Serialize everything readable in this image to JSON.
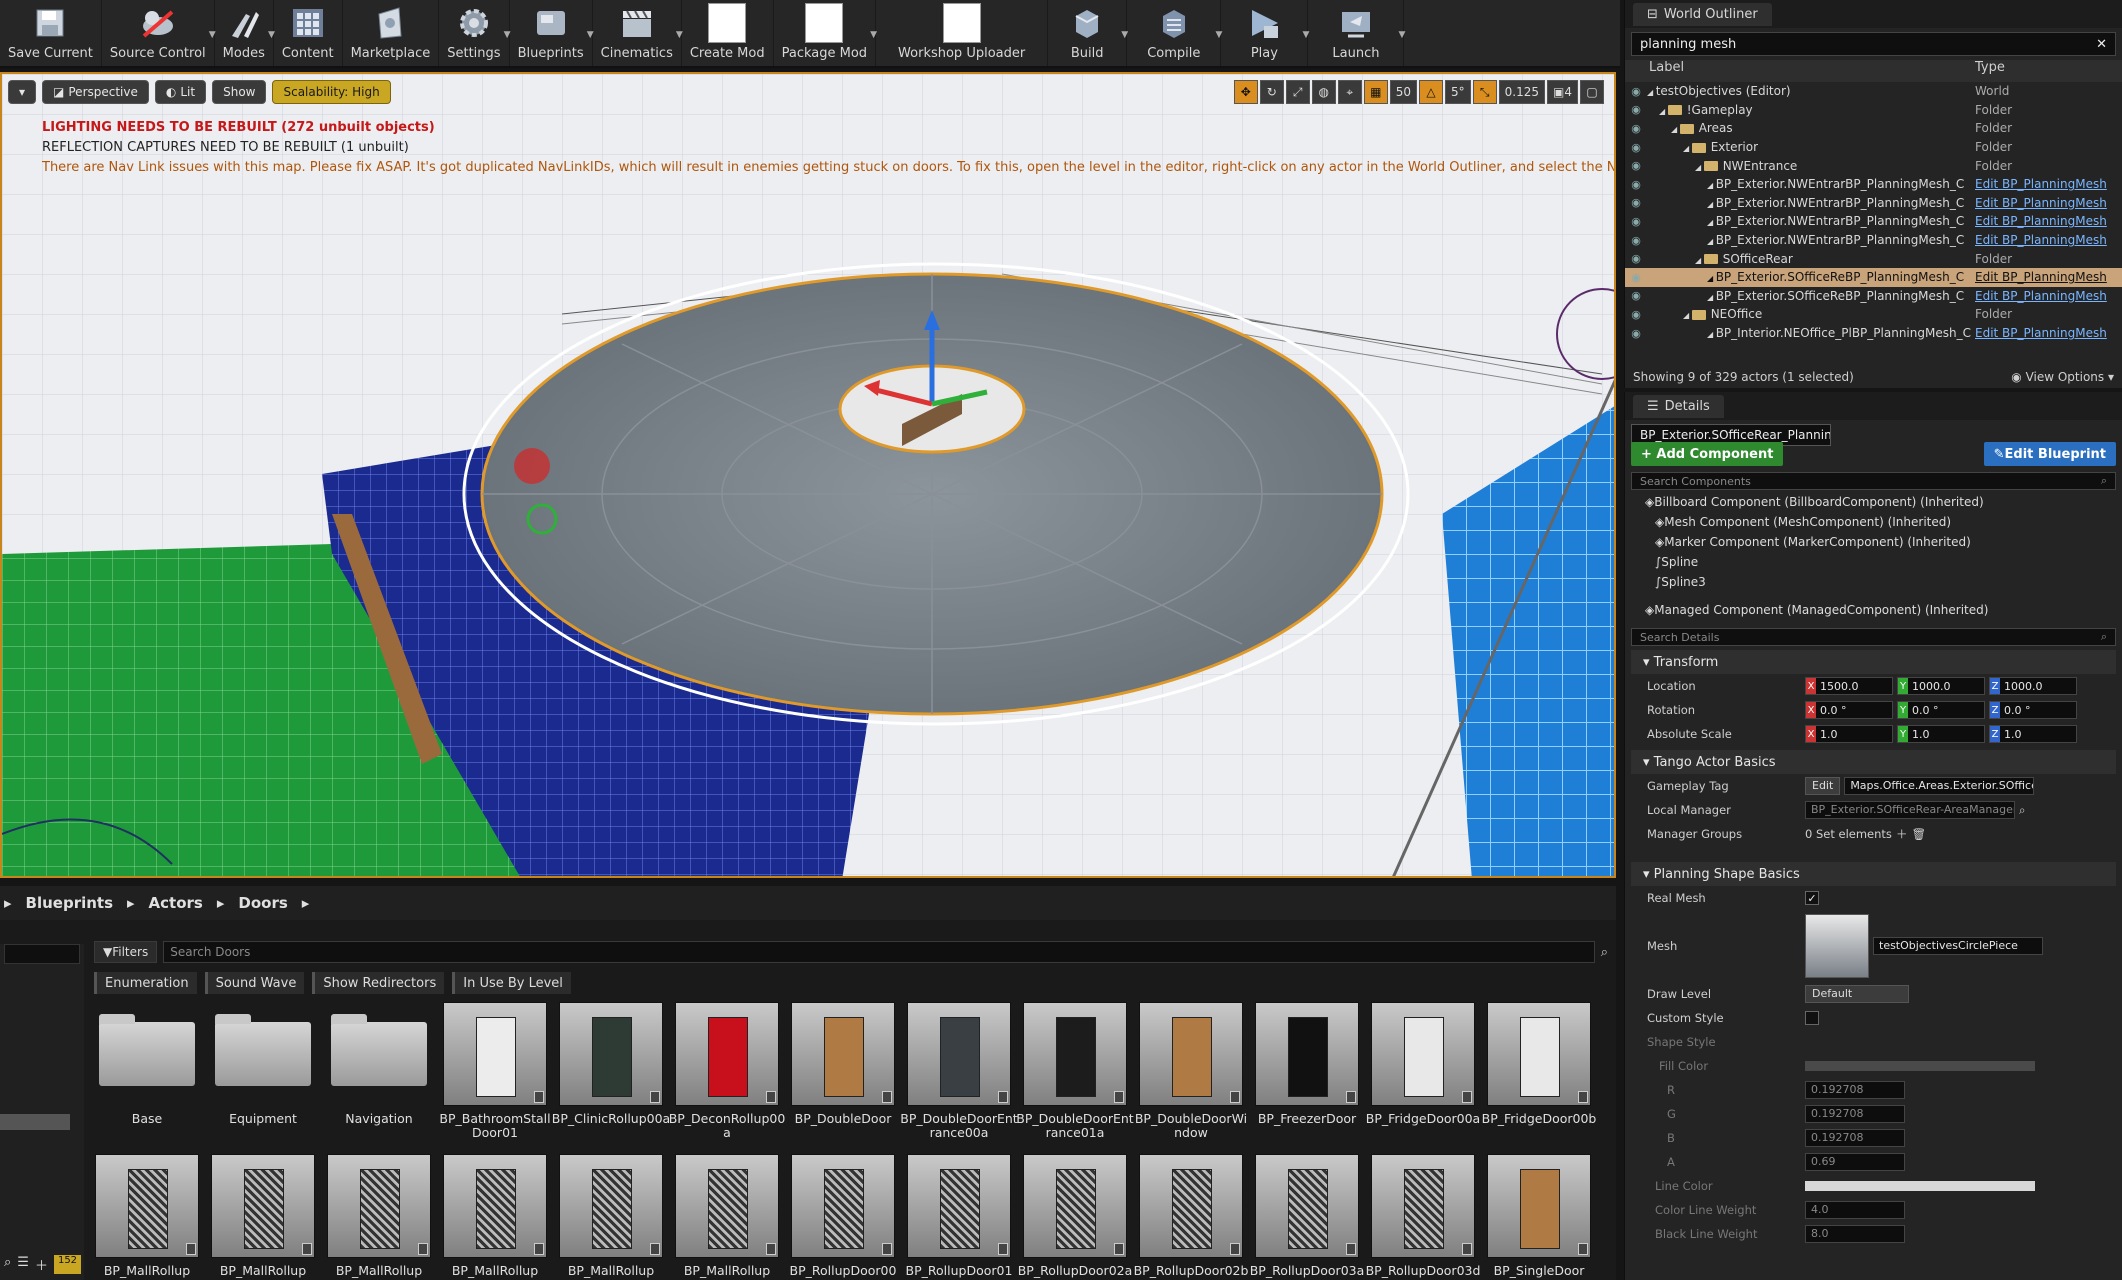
{
  "toolbar": {
    "items": [
      {
        "label": "Save Current",
        "icon": "save-icon"
      },
      {
        "label": "Source Control",
        "icon": "source-control-icon"
      },
      {
        "label": "Modes",
        "icon": "modes-icon"
      },
      {
        "label": "Content",
        "icon": "content-icon"
      },
      {
        "label": "Marketplace",
        "icon": "marketplace-icon"
      },
      {
        "label": "Settings",
        "icon": "settings-icon"
      },
      {
        "label": "Blueprints",
        "icon": "blueprints-icon"
      },
      {
        "label": "Cinematics",
        "icon": "cinematics-icon"
      },
      {
        "label": "Create Mod",
        "icon": "blank-icon"
      },
      {
        "label": "Package Mod",
        "icon": "blank-icon"
      },
      {
        "label": "Workshop Uploader",
        "icon": "blank-icon"
      },
      {
        "label": "Build",
        "icon": "build-icon"
      },
      {
        "label": "Compile",
        "icon": "compile-icon"
      },
      {
        "label": "Play",
        "icon": "play-icon"
      },
      {
        "label": "Launch",
        "icon": "launch-icon"
      }
    ]
  },
  "viewport": {
    "perspective": "Perspective",
    "lit": "Lit",
    "show": "Show",
    "scalability": "Scalability: High",
    "grid_snap": "50",
    "rot_snap": "5°",
    "scale_snap": "0.125",
    "cam_speed": "4",
    "messages": [
      "LIGHTING NEEDS TO BE REBUILT (272 unbuilt objects)",
      "REFLECTION CAPTURES NEED TO BE REBUILT (1 unbuilt)",
      "There are Nav Link issues with this map. Please fix ASAP. It's got duplicated NavLinkIDs, which will result in enemies getting stuck on doors. To fix this, open the level in the editor, right-click on any actor in the World Outliner, and select the NavLinkFix_UpdateNavLinkIDs option"
    ]
  },
  "outliner": {
    "title": "World Outliner",
    "search": "planning mesh",
    "col_label": "Label",
    "col_type": "Type",
    "rows": [
      {
        "name": "testObjectives (Editor)",
        "type": "World",
        "indent": 0,
        "folder": false,
        "link": false
      },
      {
        "name": "!Gameplay",
        "type": "Folder",
        "indent": 1,
        "folder": true,
        "link": false
      },
      {
        "name": "Areas",
        "type": "Folder",
        "indent": 2,
        "folder": true,
        "link": false
      },
      {
        "name": "Exterior",
        "type": "Folder",
        "indent": 3,
        "folder": true,
        "link": false
      },
      {
        "name": "NWEntrance",
        "type": "Folder",
        "indent": 4,
        "folder": true,
        "link": false
      },
      {
        "name": "BP_Exterior.NWEntrarBP_PlanningMesh_C",
        "type": "Edit BP_PlanningMesh",
        "indent": 5,
        "folder": false,
        "link": true
      },
      {
        "name": "BP_Exterior.NWEntrarBP_PlanningMesh_C",
        "type": "Edit BP_PlanningMesh",
        "indent": 5,
        "folder": false,
        "link": true
      },
      {
        "name": "BP_Exterior.NWEntrarBP_PlanningMesh_C",
        "type": "Edit BP_PlanningMesh",
        "indent": 5,
        "folder": false,
        "link": true
      },
      {
        "name": "BP_Exterior.NWEntrarBP_PlanningMesh_C",
        "type": "Edit BP_PlanningMesh",
        "indent": 5,
        "folder": false,
        "link": true
      },
      {
        "name": "SOfficeRear",
        "type": "Folder",
        "indent": 4,
        "folder": true,
        "link": false
      },
      {
        "name": "BP_Exterior.SOfficeReBP_PlanningMesh_C",
        "type": "Edit BP_PlanningMesh",
        "indent": 5,
        "folder": false,
        "link": true,
        "selected": true
      },
      {
        "name": "BP_Exterior.SOfficeReBP_PlanningMesh_C",
        "type": "Edit BP_PlanningMesh",
        "indent": 5,
        "folder": false,
        "link": true
      },
      {
        "name": "NEOffice",
        "type": "Folder",
        "indent": 3,
        "folder": true,
        "link": false
      },
      {
        "name": "BP_Interior.NEOffice_PlBP_PlanningMesh_C",
        "type": "Edit BP_PlanningMesh",
        "indent": 5,
        "folder": false,
        "link": true
      }
    ],
    "footer": "Showing 9 of 329 actors (1 selected)",
    "view_options": "View Options"
  },
  "details": {
    "title": "Details",
    "name": "BP_Exterior.SOfficeRear_PlanningM",
    "add_component": "+ Add Component",
    "edit_blueprint": "Edit Blueprint",
    "search_components": "Search Components",
    "components": [
      "Billboard Component (BillboardComponent) (Inherited)",
      "Mesh Component (MeshComponent) (Inherited)",
      "Marker Component (MarkerComponent) (Inherited)",
      "Spline",
      "Spline3",
      "Managed Component (ManagedComponent) (Inherited)"
    ],
    "search_details": "Search Details",
    "transform": "Transform",
    "location_label": "Location",
    "rotation_label": "Rotation",
    "scale_label": "Absolute Scale",
    "location": [
      "1500.0",
      "1000.0",
      "1000.0"
    ],
    "rotation": [
      "0.0 °",
      "0.0 °",
      "0.0 °"
    ],
    "scale": [
      "1.0",
      "1.0",
      "1.0"
    ],
    "tango": "Tango Actor Basics",
    "gameplay_tag_label": "Gameplay Tag",
    "gameplay_tag_btn": "Edit",
    "gameplay_tag": "Maps.Office.Areas.Exterior.SOfficeRear",
    "local_manager_label": "Local Manager",
    "local_manager": "BP_Exterior.SOfficeRear-AreaManager",
    "manager_groups_label": "Manager Groups",
    "manager_groups": "0 Set elements",
    "planning": "Planning Shape Basics",
    "real_mesh_label": "Real Mesh",
    "mesh_label": "Mesh",
    "mesh": "testObjectivesCirclePiece",
    "draw_level_label": "Draw Level",
    "draw_level": "Default",
    "custom_style_label": "Custom Style",
    "shape_style_label": "Shape Style",
    "fill_color_label": "Fill Color",
    "r_label": "R",
    "g_label": "G",
    "b_label": "B",
    "a_label": "A",
    "r": "0.192708",
    "g": "0.192708",
    "b": "0.192708",
    "a": "0.69",
    "line_color_label": "Line Color",
    "color_line_weight_label": "Color Line Weight",
    "color_line_weight": "4.0",
    "black_line_weight_label": "Black Line Weight",
    "black_line_weight": "8.0"
  },
  "content": {
    "breadcrumb": [
      "Blueprints",
      "Actors",
      "Doors"
    ],
    "filters": "Filters",
    "search_placeholder": "Search Doors",
    "chips": [
      "Enumeration",
      "Sound Wave",
      "Show Redirectors",
      "In Use By Level"
    ],
    "folders": [
      "Base",
      "Equipment",
      "Navigation"
    ],
    "assets_row1": [
      "BP_BathroomStallDoor01",
      "BP_ClinicRollup00a",
      "BP_DeconRollup00a",
      "BP_DoubleDoor",
      "BP_DoubleDoorEntrance00a",
      "BP_DoubleDoorEntrance01a",
      "BP_DoubleDoorWindow",
      "BP_FreezerDoor",
      "BP_FridgeDoor00a",
      "BP_FridgeDoor00b"
    ],
    "assets_row2": [
      "BP_MallRollup",
      "BP_MallRollup",
      "BP_MallRollup",
      "BP_MallRollup",
      "BP_MallRollup",
      "BP_MallRollup",
      "BP_RollupDoor00",
      "BP_RollupDoor01",
      "BP_RollupDoor02a",
      "BP_RollupDoor02b",
      "BP_RollupDoor03a",
      "BP_RollupDoor03d",
      "BP_SingleDoor"
    ],
    "count": "152"
  },
  "colors": {
    "accent": "#d98e1f",
    "selected": "#c9a37a",
    "link": "#7ab6ff",
    "add": "#2f8a2f",
    "blueprint": "#2a6fc0"
  }
}
